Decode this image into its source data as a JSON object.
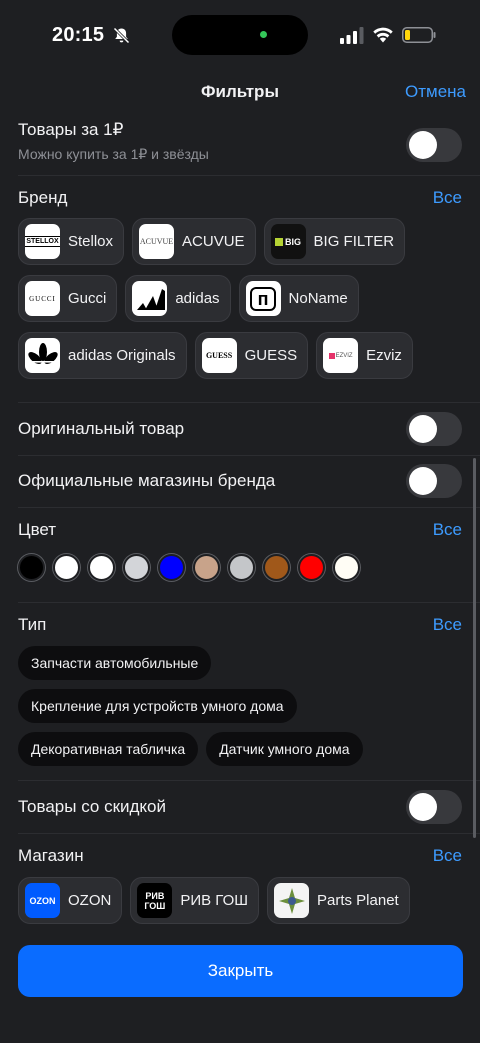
{
  "status": {
    "time": "20:15"
  },
  "nav": {
    "title": "Фильтры",
    "cancel": "Отмена"
  },
  "one_ruble": {
    "label": "Товары за 1₽",
    "sub": "Можно купить за 1₽ и звёзды",
    "on": false
  },
  "brand": {
    "title": "Бренд",
    "all": "Все",
    "items": [
      {
        "name": "Stellox",
        "logo_text": "STELLOX"
      },
      {
        "name": "ACUVUE",
        "logo_text": "ACUVUE"
      },
      {
        "name": "BIG FILTER",
        "logo_text": "BIG"
      },
      {
        "name": "Gucci",
        "logo_text": "GUCCI"
      },
      {
        "name": "adidas",
        "logo_text": ""
      },
      {
        "name": "NoName",
        "logo_text": "п"
      },
      {
        "name": "adidas Originals",
        "logo_text": ""
      },
      {
        "name": "GUESS",
        "logo_text": "GUESS"
      },
      {
        "name": "Ezviz",
        "logo_text": "EZVIZ"
      }
    ]
  },
  "original": {
    "label": "Оригинальный товар",
    "on": false
  },
  "official": {
    "label": "Официальные магазины бренда",
    "on": false
  },
  "color": {
    "title": "Цвет",
    "all": "Все",
    "swatches": [
      "#000000",
      "#ffffff",
      "#ffffff",
      "#d3d5d9",
      "#0000ff",
      "#c8a38a",
      "#c4c6c9",
      "#a0581a",
      "#ff0000",
      "#fffdf5"
    ]
  },
  "type": {
    "title": "Тип",
    "all": "Все",
    "items": [
      "Запчасти автомобильные",
      "Крепление для устройств умного дома",
      "Декоративная табличка",
      "Датчик умного дома"
    ]
  },
  "discount": {
    "label": "Товары со скидкой",
    "on": false
  },
  "store": {
    "title": "Магазин",
    "all": "Все",
    "items": [
      {
        "name": "OZON",
        "logo_text": "OZON"
      },
      {
        "name": "РИВ ГОШ",
        "logo_text": "РИВ ГОШ"
      },
      {
        "name": "Parts Planet",
        "logo_text": ""
      }
    ]
  },
  "footer": {
    "close": "Закрыть"
  }
}
